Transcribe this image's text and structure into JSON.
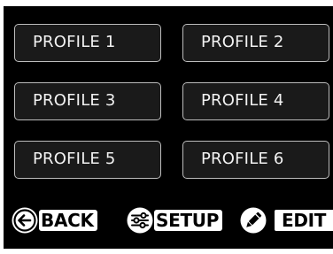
{
  "profiles": [
    {
      "label": "PROFILE 1"
    },
    {
      "label": "PROFILE 2"
    },
    {
      "label": "PROFILE 3"
    },
    {
      "label": "PROFILE 4"
    },
    {
      "label": "PROFILE 5"
    },
    {
      "label": "PROFILE 6"
    }
  ],
  "actions": {
    "back": {
      "label": "BACK",
      "icon": "back-arrow-icon"
    },
    "setup": {
      "label": "SETUP",
      "icon": "setup-sliders-icon"
    },
    "edit": {
      "label": "EDIT",
      "icon": "pencil-icon"
    }
  },
  "colors": {
    "background": "#000000",
    "button_fill": "#1a1a1a",
    "button_border": "#bdbdbd",
    "button_text": "#f2f2f2",
    "action_fill": "#ffffff"
  }
}
